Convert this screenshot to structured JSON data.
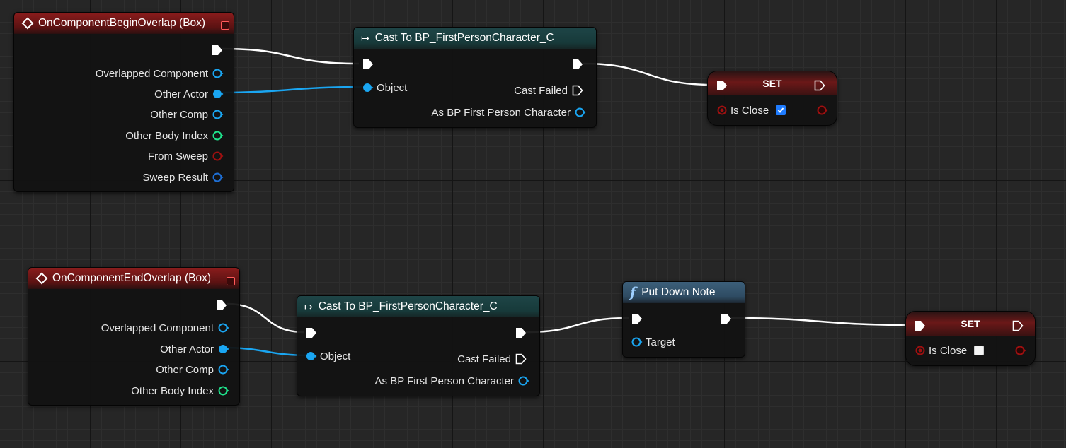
{
  "colors": {
    "canvas": "#262626",
    "event_header": "#8a1c1c",
    "cast_header": "#1e4547",
    "func_header": "#3c5f7a",
    "set_header": "#6b1818",
    "object_pin": "#1aa6f2",
    "struct_pin": "#1e6fd6",
    "int_pin": "#1fe38c",
    "bool_pin": "#a01010",
    "exec_wire": "#ffffff"
  },
  "begin_event": {
    "title": "OnComponentBeginOverlap (Box)",
    "pins": [
      {
        "label": "Overlapped Component",
        "type": "object"
      },
      {
        "label": "Other Actor",
        "type": "object",
        "connected": true
      },
      {
        "label": "Other Comp",
        "type": "object"
      },
      {
        "label": "Other Body Index",
        "type": "int"
      },
      {
        "label": "From Sweep",
        "type": "bool"
      },
      {
        "label": "Sweep Result",
        "type": "struct"
      }
    ]
  },
  "cast_top": {
    "title": "Cast To BP_FirstPersonCharacter_C",
    "input_object": "Object",
    "cast_failed": "Cast Failed",
    "as_output": "As BP First Person Character"
  },
  "set_top": {
    "title": "SET",
    "var_label": "Is Close",
    "checked": true
  },
  "end_event": {
    "title": "OnComponentEndOverlap (Box)",
    "pins": [
      {
        "label": "Overlapped Component",
        "type": "object"
      },
      {
        "label": "Other Actor",
        "type": "object",
        "connected": true
      },
      {
        "label": "Other Comp",
        "type": "object"
      },
      {
        "label": "Other Body Index",
        "type": "int"
      }
    ]
  },
  "cast_bottom": {
    "title": "Cast To BP_FirstPersonCharacter_C",
    "input_object": "Object",
    "cast_failed": "Cast Failed",
    "as_output": "As BP First Person Character"
  },
  "put_down": {
    "title": "Put Down Note",
    "target": "Target"
  },
  "set_bottom": {
    "title": "SET",
    "var_label": "Is Close",
    "checked": false
  }
}
